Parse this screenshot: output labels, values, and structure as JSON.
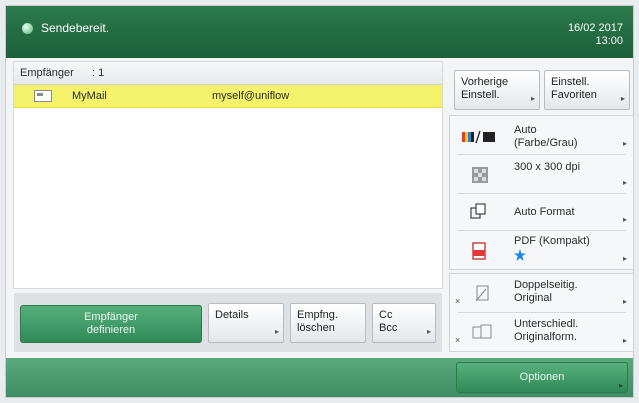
{
  "header": {
    "status": "Sendebereit.",
    "date": "16/02 2017",
    "time": "13:00"
  },
  "recipients": {
    "label": "Empfänger",
    "count": ": 1",
    "rows": [
      {
        "name": "MyMail",
        "address": "myself@uniflow"
      }
    ]
  },
  "bottom_buttons": {
    "define": [
      "Empfänger",
      "definieren"
    ],
    "details": "Details",
    "delete": [
      "Empfng.",
      "löschen"
    ],
    "cc": [
      "Cc",
      "Bcc"
    ]
  },
  "right_top": {
    "prev": [
      "Vorherige",
      "Einstell."
    ],
    "fav": [
      "Einstell.",
      "Favoriten"
    ]
  },
  "settings": {
    "color": [
      "Auto",
      "(Farbe/Grau)"
    ],
    "resolution": "300 x 300 dpi",
    "format": "Auto Format",
    "filetype": "PDF (Kompakt)"
  },
  "duplex": {
    "double": [
      "Doppelseitig.",
      "Original"
    ],
    "different": [
      "Unterschiedl.",
      "Originalform."
    ]
  },
  "options_label": "Optionen",
  "arrow_glyph": "▸",
  "colors": {
    "header": "#1f6a3f",
    "selected_row": "#f4f16b",
    "green_button": "#3f9a66"
  }
}
